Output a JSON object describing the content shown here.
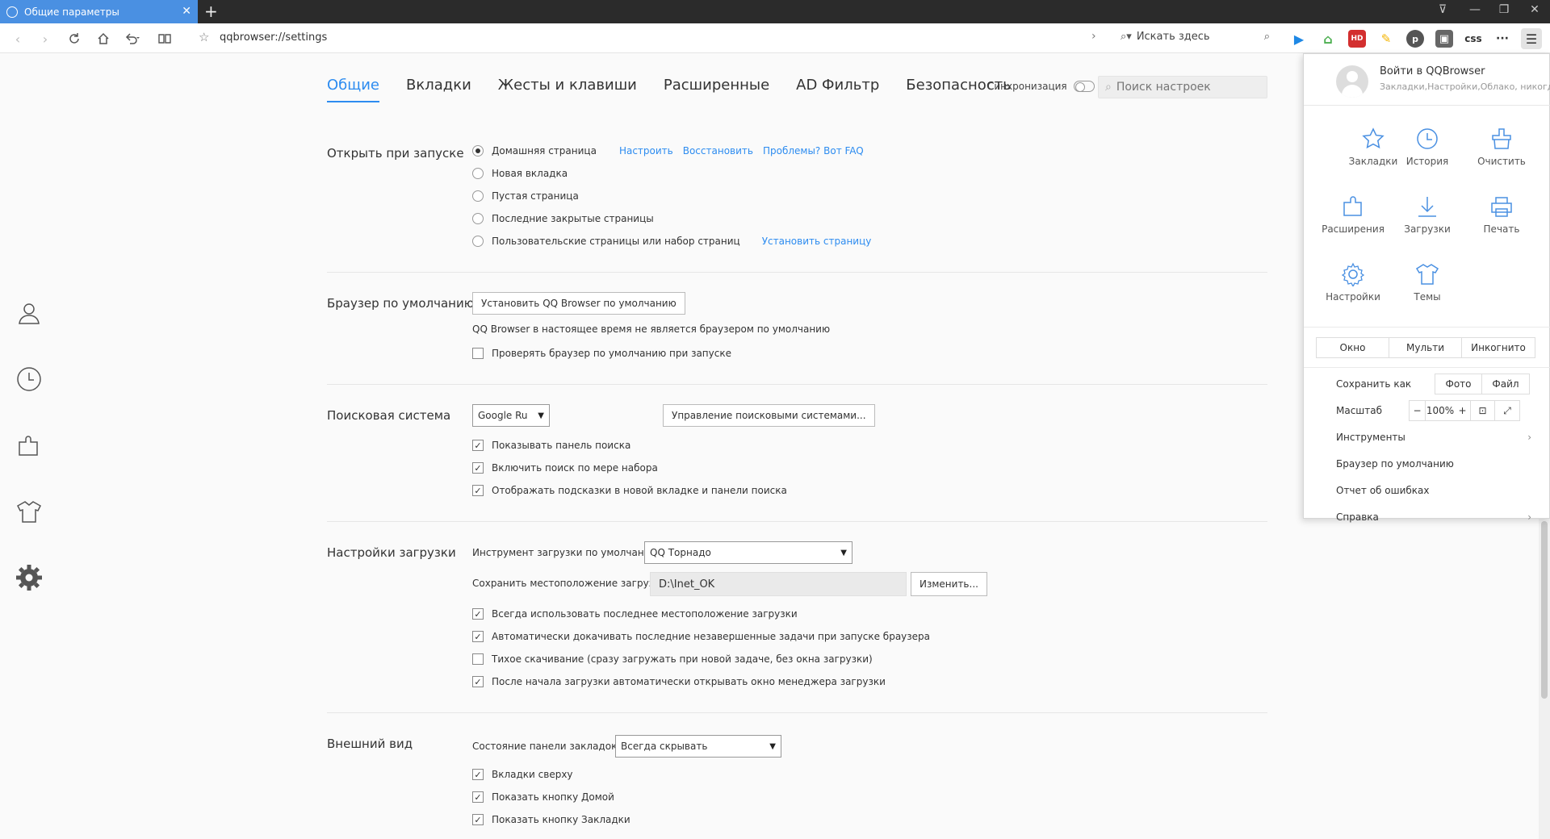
{
  "tab": {
    "title": "Общие параметры"
  },
  "toolbar": {
    "url": "qqbrowser://settings",
    "search_placeholder": "Искать здесь"
  },
  "extensions": [
    "play-icon",
    "house-icon",
    "rss-icon",
    "brush-icon",
    "p-icon",
    "image-icon"
  ],
  "ext_labels": {
    "css": "css",
    "more": "···",
    "hd": "HD"
  },
  "nav": {
    "tabs": [
      "Общие",
      "Вкладки",
      "Жесты и клавиши",
      "Расширенные",
      "AD Фильтр",
      "Безопасность"
    ],
    "sync_label": "Синхронизация",
    "search_placeholder": "Поиск настроек"
  },
  "startup": {
    "title": "Открыть при запуске",
    "options": [
      "Домашняя страница",
      "Новая вкладка",
      "Пустая страница",
      "Последние закрытые страницы",
      "Пользовательские страницы или набор страниц"
    ],
    "selected": 0,
    "links": {
      "configure": "Настроить",
      "restore": "Восстановить",
      "faq": "Проблемы? Вот FAQ",
      "set_page": "Установить страницу"
    }
  },
  "default_browser": {
    "title": "Браузер по умолчанию",
    "button": "Установить QQ Browser по умолчанию",
    "status": "QQ Browser в настоящее время не является браузером по умолчанию",
    "check_label": "Проверять браузер по умолчанию при запуске"
  },
  "search_engine": {
    "title": "Поисковая система",
    "selected": "Google Ru",
    "manage_button": "Управление поисковыми системами...",
    "options": [
      {
        "label": "Показывать панель поиска",
        "checked": true
      },
      {
        "label": "Включить поиск по мере набора",
        "checked": true
      },
      {
        "label": "Отображать подсказки в новой вкладке и панели поиска",
        "checked": true
      }
    ]
  },
  "download": {
    "title": "Настройки загрузки",
    "tool_label": "Инструмент загрузки по умолчанию",
    "tool_value": "QQ Торнадо",
    "location_label": "Сохранить местоположение загрузки",
    "location_value": "D:\\Inet_OK",
    "change_button": "Изменить...",
    "options": [
      {
        "label": "Всегда использовать последнее местоположение загрузки",
        "checked": true
      },
      {
        "label": "Автоматически докачивать последние незавершенные задачи при запуске браузера",
        "checked": true
      },
      {
        "label": "Тихое скачивание (сразу загружать при новой задаче, без окна загрузки)",
        "checked": false
      },
      {
        "label": "После начала загрузки автоматически открывать окно менеджера загрузки",
        "checked": true
      }
    ]
  },
  "appearance": {
    "title": "Внешний вид",
    "bookmarks_bar_label": "Состояние панели закладок",
    "bookmarks_bar_value": "Всегда скрывать",
    "options": [
      {
        "label": "Вкладки сверху",
        "checked": true
      },
      {
        "label": "Показать кнопку Домой",
        "checked": true
      },
      {
        "label": "Показать кнопку Закладки",
        "checked": true
      }
    ]
  },
  "menu": {
    "login": "Войти в QQBrowser",
    "login_sub": "Закладки,Настройки,Облако, никогда",
    "grid": [
      "Закладки",
      "История",
      "Очистить",
      "Расширения",
      "Загрузки",
      "Печать",
      "Настройки",
      "Темы"
    ],
    "window_modes": [
      "Окно",
      "Мульти",
      "Инкогнито"
    ],
    "save_as": "Сохранить как",
    "save_options": [
      "Фото",
      "Файл"
    ],
    "zoom_label": "Масштаб",
    "zoom_minus": "−",
    "zoom_value": "100%",
    "zoom_plus": "+",
    "items": [
      "Инструменты",
      "Браузер по умолчанию",
      "Отчет об ошибках",
      "Справка"
    ]
  },
  "colors": {
    "accent": "#2d8cf0",
    "tab": "#4a90e2",
    "titlebar": "#2b2b2b"
  }
}
